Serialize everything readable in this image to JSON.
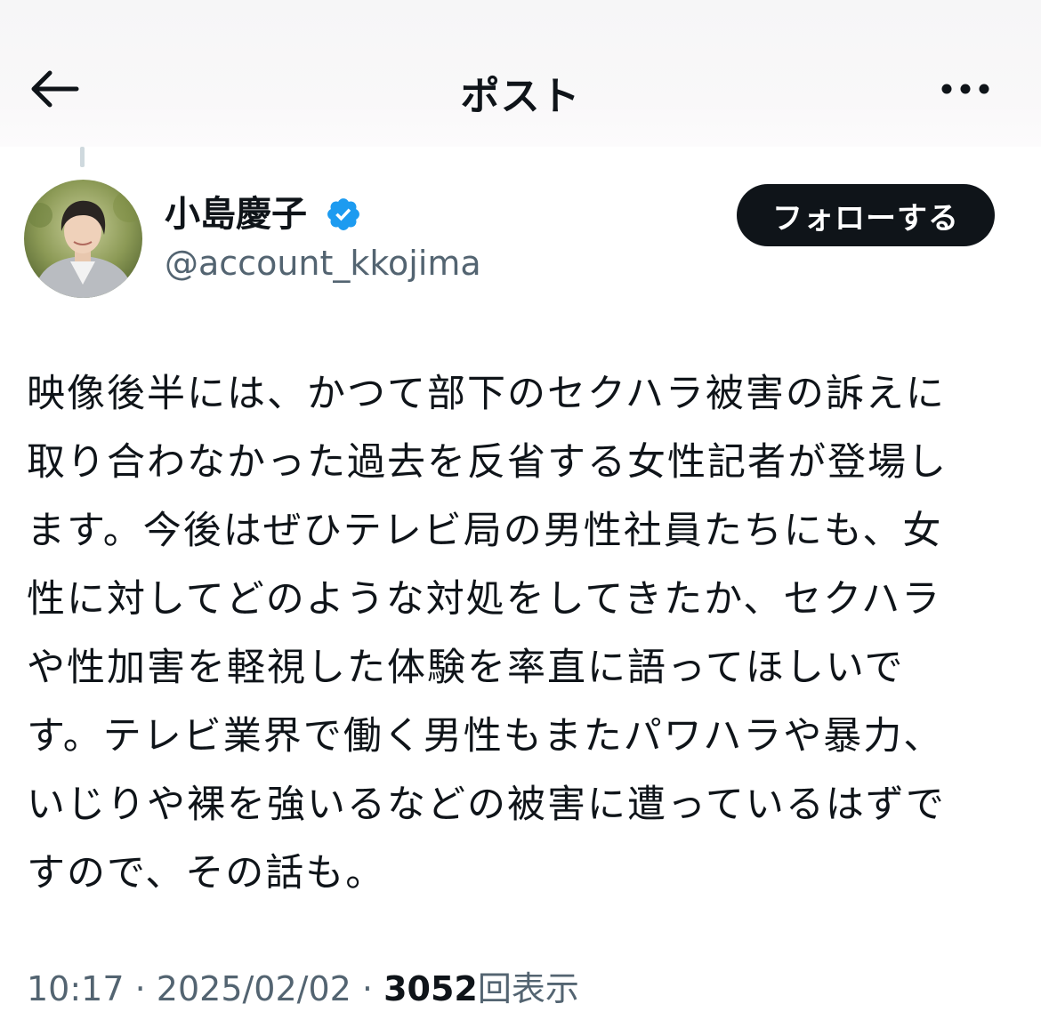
{
  "header": {
    "title": "ポスト"
  },
  "author": {
    "display_name": "小島慶子",
    "handle": "@account_kkojima",
    "verified": true,
    "follow_label": "フォローする"
  },
  "post": {
    "lines": [
      "映像後半には、かつて部下のセクハラ被害の訴えに",
      "取り合わなかった過去を反省する女性記者が登場し",
      "ます。今後はぜひテレビ局の男性社員たちにも、女",
      "性に対してどのような対処をしてきたか、セクハラ",
      "や性加害を軽視した体験を率直に語ってほしいで",
      "す。テレビ業界で働く男性もまたパワハラや暴力、",
      "いじりや裸を強いるなどの被害に遭っているはずで",
      "すので、その話も。"
    ]
  },
  "meta": {
    "time": "10:17",
    "separator": "·",
    "date": "2025/02/02",
    "views_count": "3052",
    "views_label": "回表示"
  },
  "icons": {
    "back": "arrow-left-icon",
    "more": "more-horizontal-icon",
    "verified": "verified-badge-icon"
  },
  "colors": {
    "text": "#0f1419",
    "secondary": "#536471",
    "verified": "#1d9bf0",
    "follow_bg": "#0f1419"
  }
}
